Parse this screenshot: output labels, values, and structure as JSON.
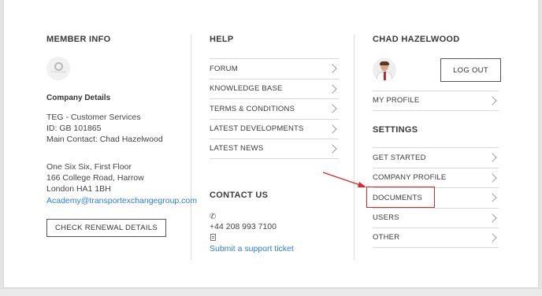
{
  "member_info": {
    "heading": "MEMBER INFO",
    "logo_text": "Company logo",
    "company_details_title": "Company Details",
    "company_name": "TEG - Customer Services",
    "company_id": "ID: GB 101865",
    "main_contact": "Main Contact: Chad Hazelwood",
    "address_line1": "One Six Six, First Floor",
    "address_line2": "166 College Road, Harrow",
    "address_line3": "London HA1 1BH",
    "email": "Academy@transportexchangegroup.com",
    "renewal_button": "CHECK RENEWAL DETAILS"
  },
  "help": {
    "heading": "HELP",
    "items": [
      {
        "label": "FORUM"
      },
      {
        "label": "KNOWLEDGE BASE"
      },
      {
        "label": "TERMS & CONDITIONS"
      },
      {
        "label": "LATEST DEVELOPMENTS"
      },
      {
        "label": "LATEST NEWS"
      }
    ]
  },
  "contact": {
    "heading": "CONTACT US",
    "phone": "+44 208 993 7100",
    "support_link": "Submit a support ticket"
  },
  "user": {
    "name": "CHAD HAZELWOOD",
    "logout_button": "LOG OUT",
    "profile_items": [
      {
        "label": "MY PROFILE"
      }
    ]
  },
  "settings": {
    "heading": "SETTINGS",
    "items": [
      {
        "label": "GET STARTED"
      },
      {
        "label": "COMPANY PROFILE"
      },
      {
        "label": "DOCUMENTS"
      },
      {
        "label": "USERS"
      },
      {
        "label": "OTHER"
      }
    ]
  },
  "annotation": {
    "highlight_color": "#d62a2a"
  },
  "colors": {
    "link": "#2a7fd4",
    "text": "#3a3a3a",
    "divider": "#d8d8d8"
  }
}
